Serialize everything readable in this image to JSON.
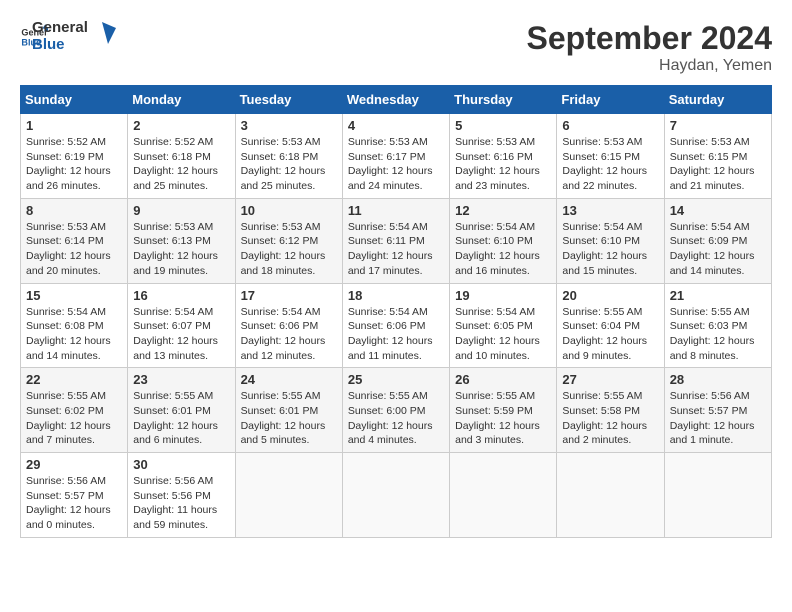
{
  "header": {
    "logo_general": "General",
    "logo_blue": "Blue",
    "month_title": "September 2024",
    "location": "Haydan, Yemen"
  },
  "weekdays": [
    "Sunday",
    "Monday",
    "Tuesday",
    "Wednesday",
    "Thursday",
    "Friday",
    "Saturday"
  ],
  "weeks": [
    [
      {
        "day": "1",
        "sunrise": "5:52 AM",
        "sunset": "6:19 PM",
        "daylight": "12 hours and 26 minutes."
      },
      {
        "day": "2",
        "sunrise": "5:52 AM",
        "sunset": "6:18 PM",
        "daylight": "12 hours and 25 minutes."
      },
      {
        "day": "3",
        "sunrise": "5:53 AM",
        "sunset": "6:18 PM",
        "daylight": "12 hours and 25 minutes."
      },
      {
        "day": "4",
        "sunrise": "5:53 AM",
        "sunset": "6:17 PM",
        "daylight": "12 hours and 24 minutes."
      },
      {
        "day": "5",
        "sunrise": "5:53 AM",
        "sunset": "6:16 PM",
        "daylight": "12 hours and 23 minutes."
      },
      {
        "day": "6",
        "sunrise": "5:53 AM",
        "sunset": "6:15 PM",
        "daylight": "12 hours and 22 minutes."
      },
      {
        "day": "7",
        "sunrise": "5:53 AM",
        "sunset": "6:15 PM",
        "daylight": "12 hours and 21 minutes."
      }
    ],
    [
      {
        "day": "8",
        "sunrise": "5:53 AM",
        "sunset": "6:14 PM",
        "daylight": "12 hours and 20 minutes."
      },
      {
        "day": "9",
        "sunrise": "5:53 AM",
        "sunset": "6:13 PM",
        "daylight": "12 hours and 19 minutes."
      },
      {
        "day": "10",
        "sunrise": "5:53 AM",
        "sunset": "6:12 PM",
        "daylight": "12 hours and 18 minutes."
      },
      {
        "day": "11",
        "sunrise": "5:54 AM",
        "sunset": "6:11 PM",
        "daylight": "12 hours and 17 minutes."
      },
      {
        "day": "12",
        "sunrise": "5:54 AM",
        "sunset": "6:10 PM",
        "daylight": "12 hours and 16 minutes."
      },
      {
        "day": "13",
        "sunrise": "5:54 AM",
        "sunset": "6:10 PM",
        "daylight": "12 hours and 15 minutes."
      },
      {
        "day": "14",
        "sunrise": "5:54 AM",
        "sunset": "6:09 PM",
        "daylight": "12 hours and 14 minutes."
      }
    ],
    [
      {
        "day": "15",
        "sunrise": "5:54 AM",
        "sunset": "6:08 PM",
        "daylight": "12 hours and 14 minutes."
      },
      {
        "day": "16",
        "sunrise": "5:54 AM",
        "sunset": "6:07 PM",
        "daylight": "12 hours and 13 minutes."
      },
      {
        "day": "17",
        "sunrise": "5:54 AM",
        "sunset": "6:06 PM",
        "daylight": "12 hours and 12 minutes."
      },
      {
        "day": "18",
        "sunrise": "5:54 AM",
        "sunset": "6:06 PM",
        "daylight": "12 hours and 11 minutes."
      },
      {
        "day": "19",
        "sunrise": "5:54 AM",
        "sunset": "6:05 PM",
        "daylight": "12 hours and 10 minutes."
      },
      {
        "day": "20",
        "sunrise": "5:55 AM",
        "sunset": "6:04 PM",
        "daylight": "12 hours and 9 minutes."
      },
      {
        "day": "21",
        "sunrise": "5:55 AM",
        "sunset": "6:03 PM",
        "daylight": "12 hours and 8 minutes."
      }
    ],
    [
      {
        "day": "22",
        "sunrise": "5:55 AM",
        "sunset": "6:02 PM",
        "daylight": "12 hours and 7 minutes."
      },
      {
        "day": "23",
        "sunrise": "5:55 AM",
        "sunset": "6:01 PM",
        "daylight": "12 hours and 6 minutes."
      },
      {
        "day": "24",
        "sunrise": "5:55 AM",
        "sunset": "6:01 PM",
        "daylight": "12 hours and 5 minutes."
      },
      {
        "day": "25",
        "sunrise": "5:55 AM",
        "sunset": "6:00 PM",
        "daylight": "12 hours and 4 minutes."
      },
      {
        "day": "26",
        "sunrise": "5:55 AM",
        "sunset": "5:59 PM",
        "daylight": "12 hours and 3 minutes."
      },
      {
        "day": "27",
        "sunrise": "5:55 AM",
        "sunset": "5:58 PM",
        "daylight": "12 hours and 2 minutes."
      },
      {
        "day": "28",
        "sunrise": "5:56 AM",
        "sunset": "5:57 PM",
        "daylight": "12 hours and 1 minute."
      }
    ],
    [
      {
        "day": "29",
        "sunrise": "5:56 AM",
        "sunset": "5:57 PM",
        "daylight": "12 hours and 0 minutes."
      },
      {
        "day": "30",
        "sunrise": "5:56 AM",
        "sunset": "5:56 PM",
        "daylight": "11 hours and 59 minutes."
      },
      null,
      null,
      null,
      null,
      null
    ]
  ]
}
